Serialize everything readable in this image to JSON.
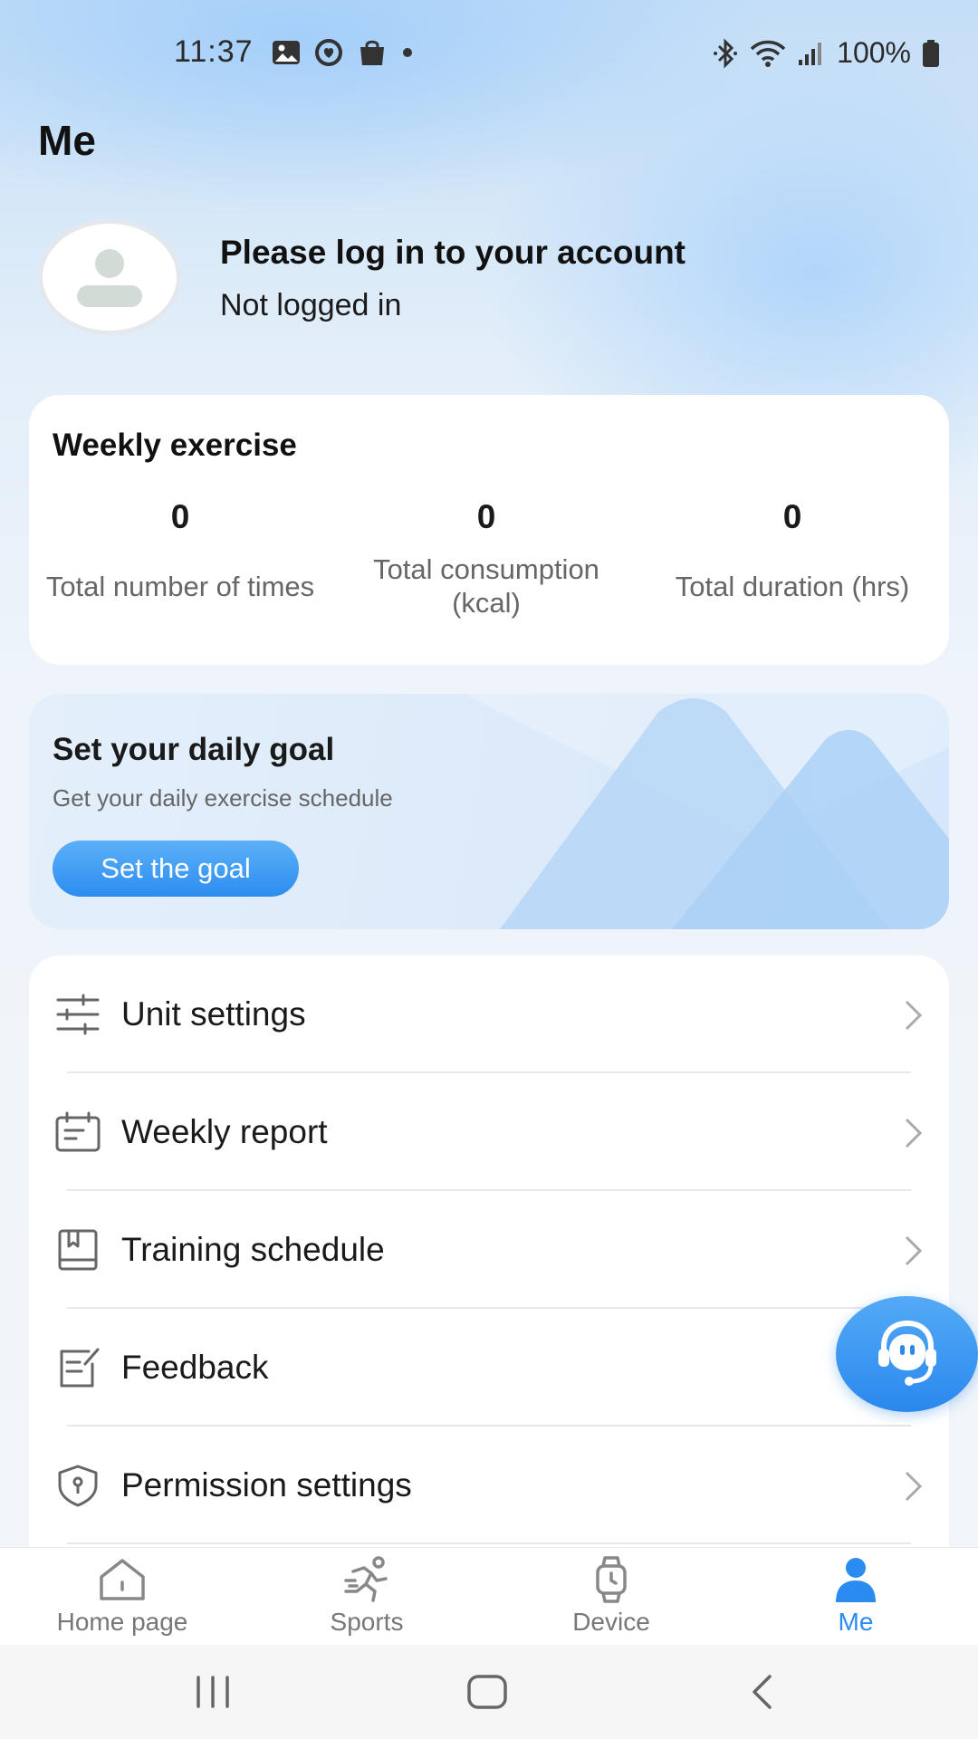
{
  "status_bar": {
    "time": "11:37",
    "battery": "100%",
    "left_icons": [
      "gallery-icon",
      "heart-face-icon",
      "shopping-bag-icon",
      "dot-icon"
    ],
    "right_icons": [
      "bluetooth-icon",
      "wifi-icon",
      "signal-icon",
      "battery-icon"
    ]
  },
  "page": {
    "title": "Me"
  },
  "profile": {
    "title": "Please log in to your account",
    "subtitle": "Not logged in"
  },
  "weekly": {
    "title": "Weekly exercise",
    "stats": [
      {
        "value": "0",
        "label": "Total number of times"
      },
      {
        "value": "0",
        "label": "Total consumption (kcal)"
      },
      {
        "value": "0",
        "label": "Total duration (hrs)"
      }
    ]
  },
  "goal": {
    "title": "Set your daily goal",
    "subtitle": "Get your daily exercise schedule",
    "button": "Set the goal"
  },
  "menu": [
    {
      "label": "Unit settings",
      "icon": "sliders-icon"
    },
    {
      "label": "Weekly report",
      "icon": "calendar-icon"
    },
    {
      "label": "Training schedule",
      "icon": "book-icon"
    },
    {
      "label": "Feedback",
      "icon": "edit-note-icon"
    },
    {
      "label": "Permission settings",
      "icon": "shield-key-icon"
    }
  ],
  "tabs": [
    {
      "label": "Home page",
      "icon": "home-icon",
      "active": false
    },
    {
      "label": "Sports",
      "icon": "runner-icon",
      "active": false
    },
    {
      "label": "Device",
      "icon": "watch-icon",
      "active": false
    },
    {
      "label": "Me",
      "icon": "person-icon",
      "active": true
    }
  ],
  "colors": {
    "accent": "#2a8cf0",
    "inactive": "#777777"
  }
}
